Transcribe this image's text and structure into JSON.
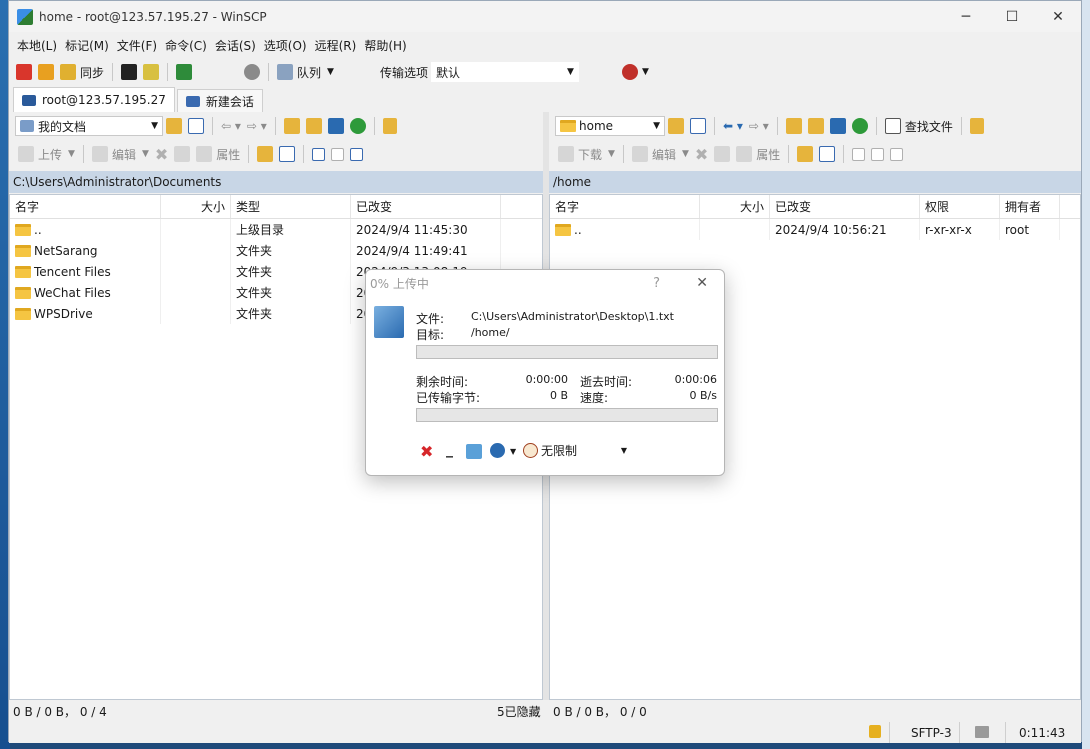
{
  "window": {
    "title": "home - root@123.57.195.27 - WinSCP",
    "min": "─",
    "max": "☐",
    "close": "✕"
  },
  "menu": [
    "本地(L)",
    "标记(M)",
    "文件(F)",
    "命令(C)",
    "会话(S)",
    "选项(O)",
    "远程(R)",
    "帮助(H)"
  ],
  "toolbar": {
    "sync": "同步",
    "queue": "队列",
    "transfer_options": "传输选项",
    "transfer_preset": "默认"
  },
  "tabs": [
    {
      "label": "root@123.57.195.27"
    },
    {
      "label": "新建会话"
    }
  ],
  "left": {
    "location": "我的文档",
    "actions": {
      "upload": "上传",
      "edit": "编辑",
      "props": "属性"
    },
    "path": "C:\\Users\\Administrator\\Documents",
    "headers": {
      "name": "名字",
      "size": "大小",
      "type": "类型",
      "changed": "已改变"
    },
    "rows": [
      {
        "name": "..",
        "size": "",
        "type": "上级目录",
        "changed": "2024/9/4  11:45:30"
      },
      {
        "name": "NetSarang",
        "size": "",
        "type": "文件夹",
        "changed": "2024/9/4  11:49:41"
      },
      {
        "name": "Tencent Files",
        "size": "",
        "type": "文件夹",
        "changed": "2024/9/3  13:08:19"
      },
      {
        "name": "WeChat Files",
        "size": "",
        "type": "文件夹",
        "changed": "20"
      },
      {
        "name": "WPSDrive",
        "size": "",
        "type": "文件夹",
        "changed": "20"
      }
    ],
    "status": "0 B / 0 B， 0 / 4",
    "hidden": "5已隐藏"
  },
  "right": {
    "location": "home",
    "actions": {
      "download": "下载",
      "edit": "编辑",
      "props": "属性",
      "find": "查找文件"
    },
    "path": "/home",
    "headers": {
      "name": "名字",
      "size": "大小",
      "changed": "已改变",
      "rights": "权限",
      "owner": "拥有者"
    },
    "rows": [
      {
        "name": "..",
        "size": "",
        "changed": "2024/9/4 10:56:21",
        "rights": "r-xr-xr-x",
        "owner": "root"
      }
    ],
    "status": "0 B / 0 B， 0 / 0"
  },
  "bottom": {
    "protocol": "SFTP-3",
    "time": "0:11:43"
  },
  "dialog": {
    "title": "0% 上传中",
    "help": "?",
    "close": "✕",
    "file_label": "文件:",
    "file": "C:\\Users\\Administrator\\Desktop\\1.txt",
    "target_label": "目标:",
    "target": "/home/",
    "remaining_label": "剩余时间:",
    "remaining": "0:00:00",
    "elapsed_label": "逝去时间:",
    "elapsed": "0:00:06",
    "bytes_label": "已传输字节:",
    "bytes": "0 B",
    "speed_label": "速度:",
    "speed": "0 B/s",
    "file_progress": 0,
    "total_progress": 0,
    "minimize": "_",
    "speed_limit": "无限制"
  }
}
